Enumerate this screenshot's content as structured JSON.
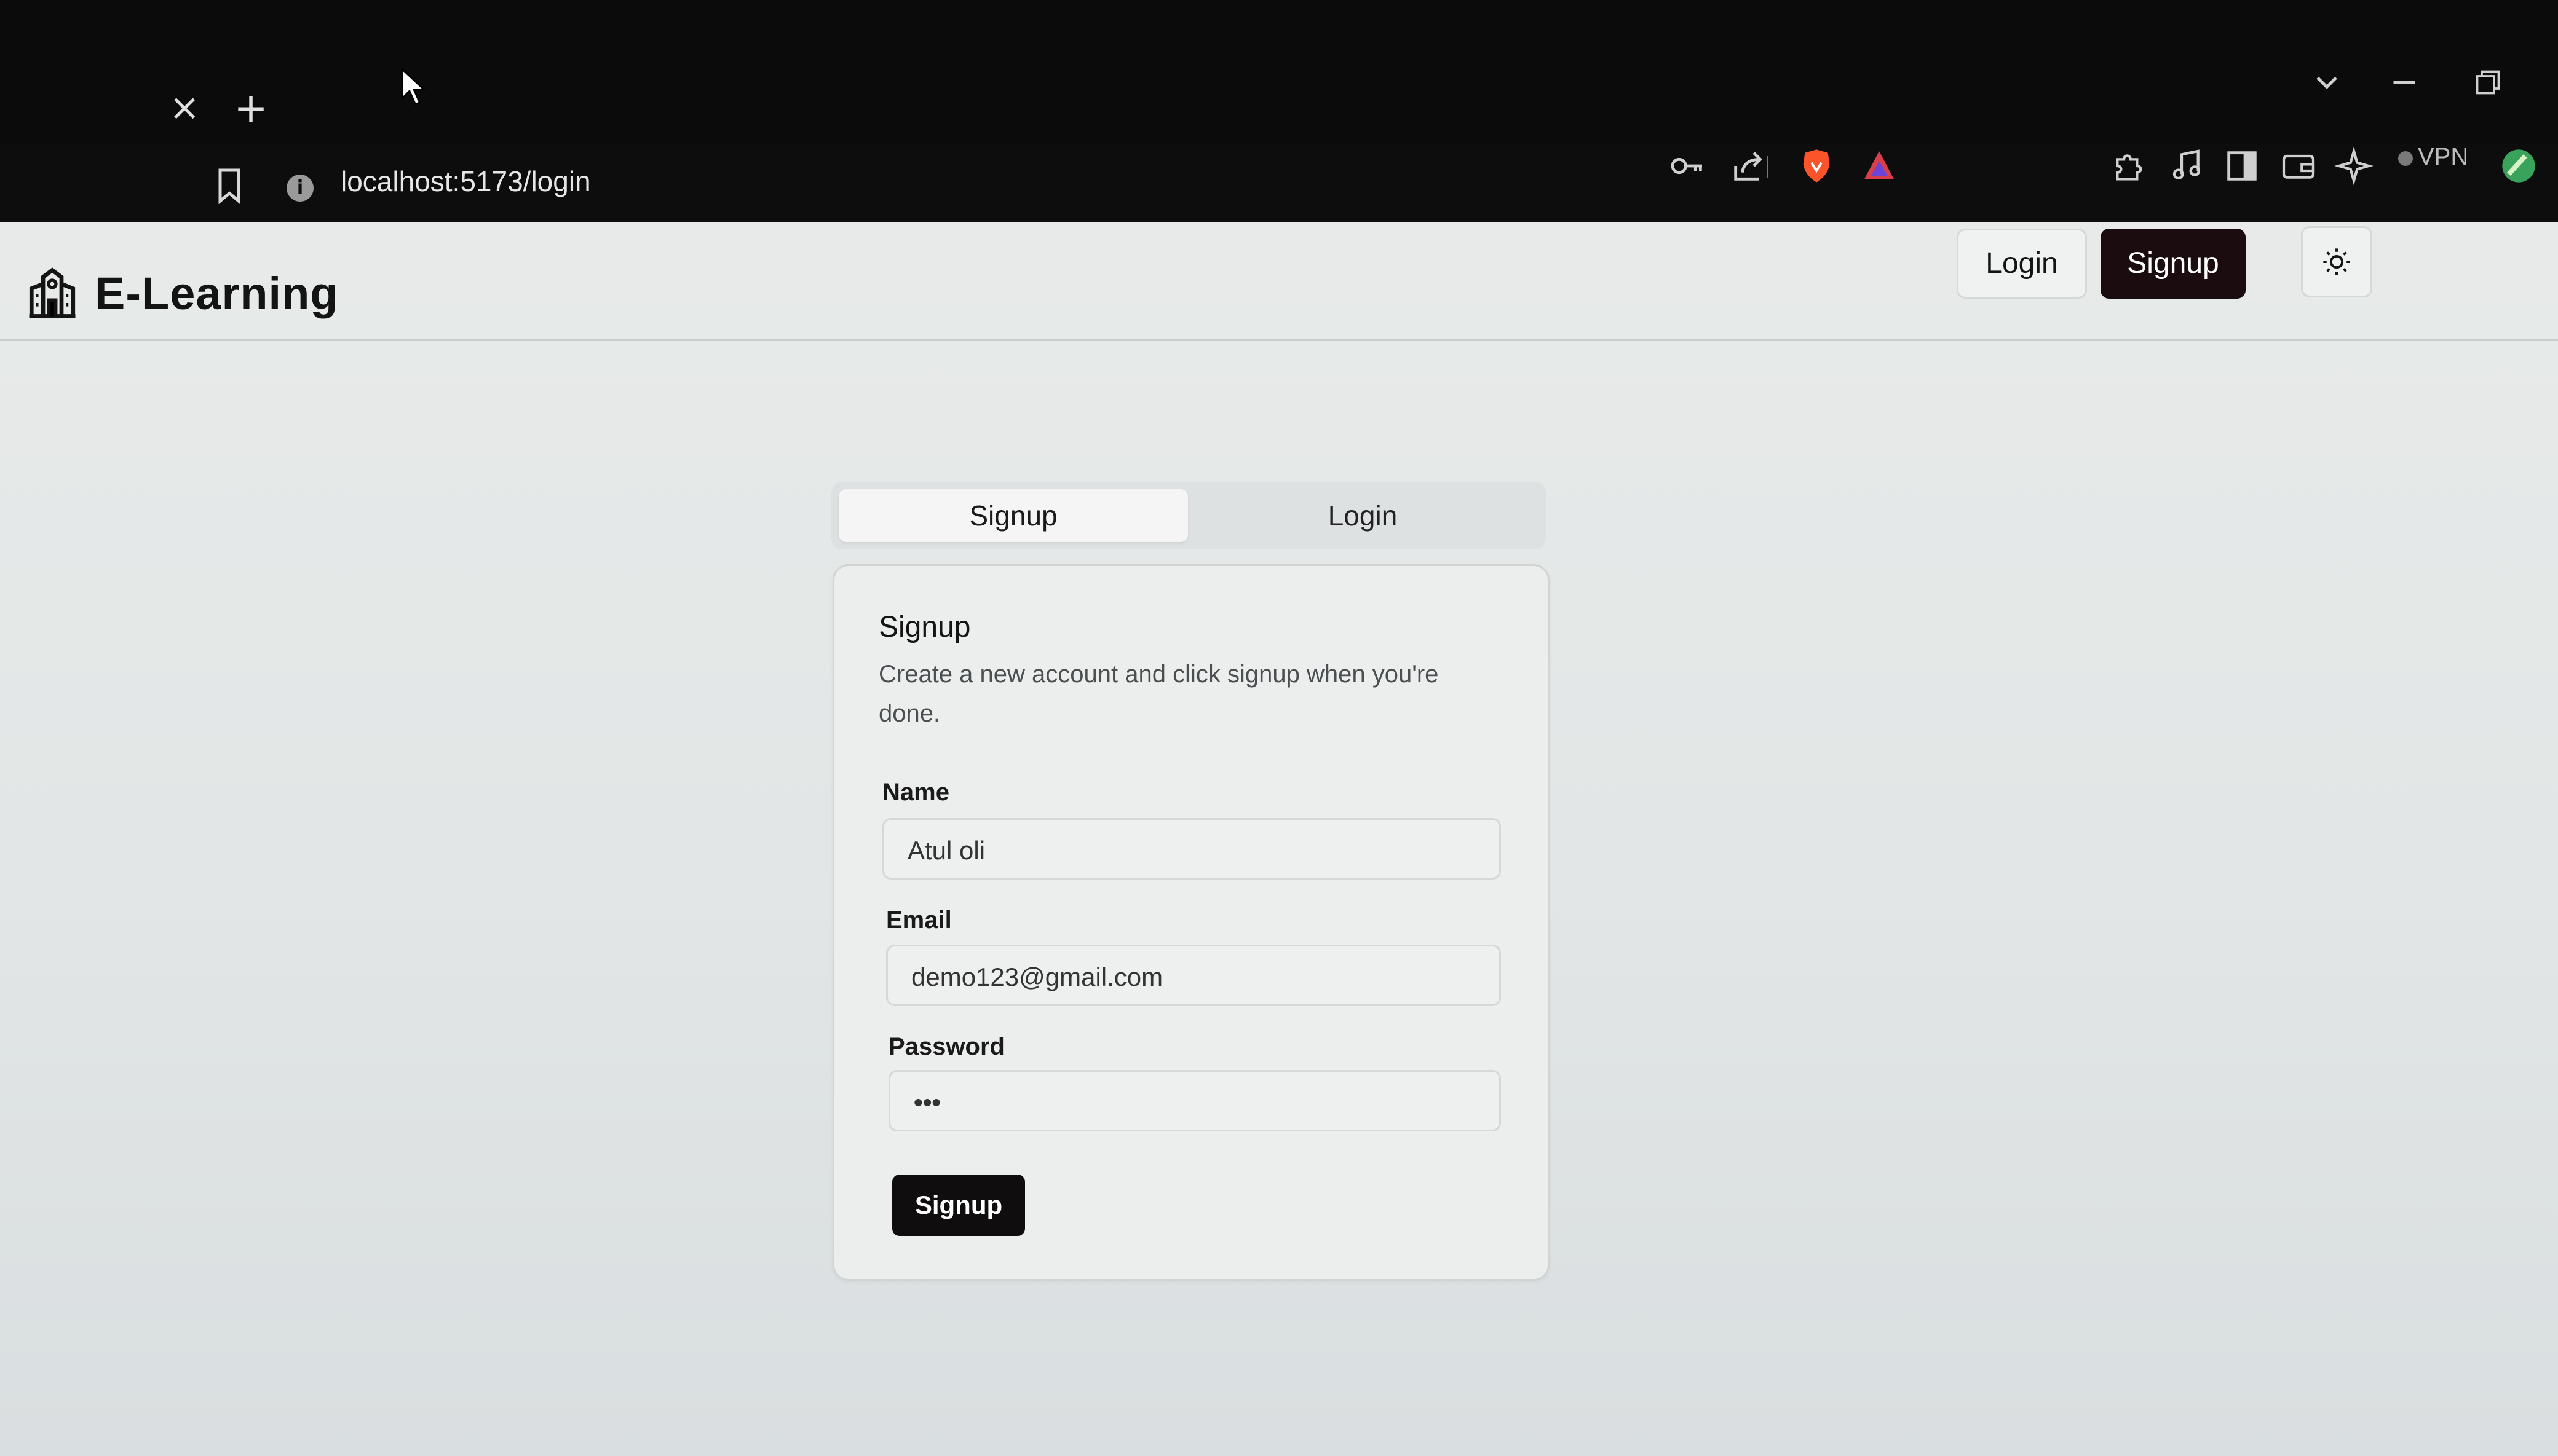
{
  "browser": {
    "tab_close_icon": "close-icon",
    "new_tab_icon": "plus-icon",
    "url": "localhost:5173/login",
    "vpn_label": "VPN",
    "toolbar_icons": [
      "key-icon",
      "share-icon",
      "brave-shield-icon",
      "brave-rewards-icon",
      "extensions-icon",
      "music-icon",
      "sidebar-icon",
      "wallet-icon",
      "leo-ai-icon",
      "vpn-icon",
      "profile-icon"
    ]
  },
  "header": {
    "brand": "E-Learning",
    "login_label": "Login",
    "signup_label": "Signup",
    "theme_icon": "sun-icon",
    "accent_color": "#1b0d0f"
  },
  "tabs": [
    {
      "label": "Signup",
      "active": true
    },
    {
      "label": "Login",
      "active": false
    }
  ],
  "card": {
    "title": "Signup",
    "description": "Create a new account and click signup when you're done.",
    "fields": [
      {
        "label": "Name",
        "value": "Atul oli"
      },
      {
        "label": "Email",
        "value": "demo123@gmail.com"
      },
      {
        "label": "Password",
        "value": "•••"
      }
    ],
    "submit_label": "Signup"
  }
}
